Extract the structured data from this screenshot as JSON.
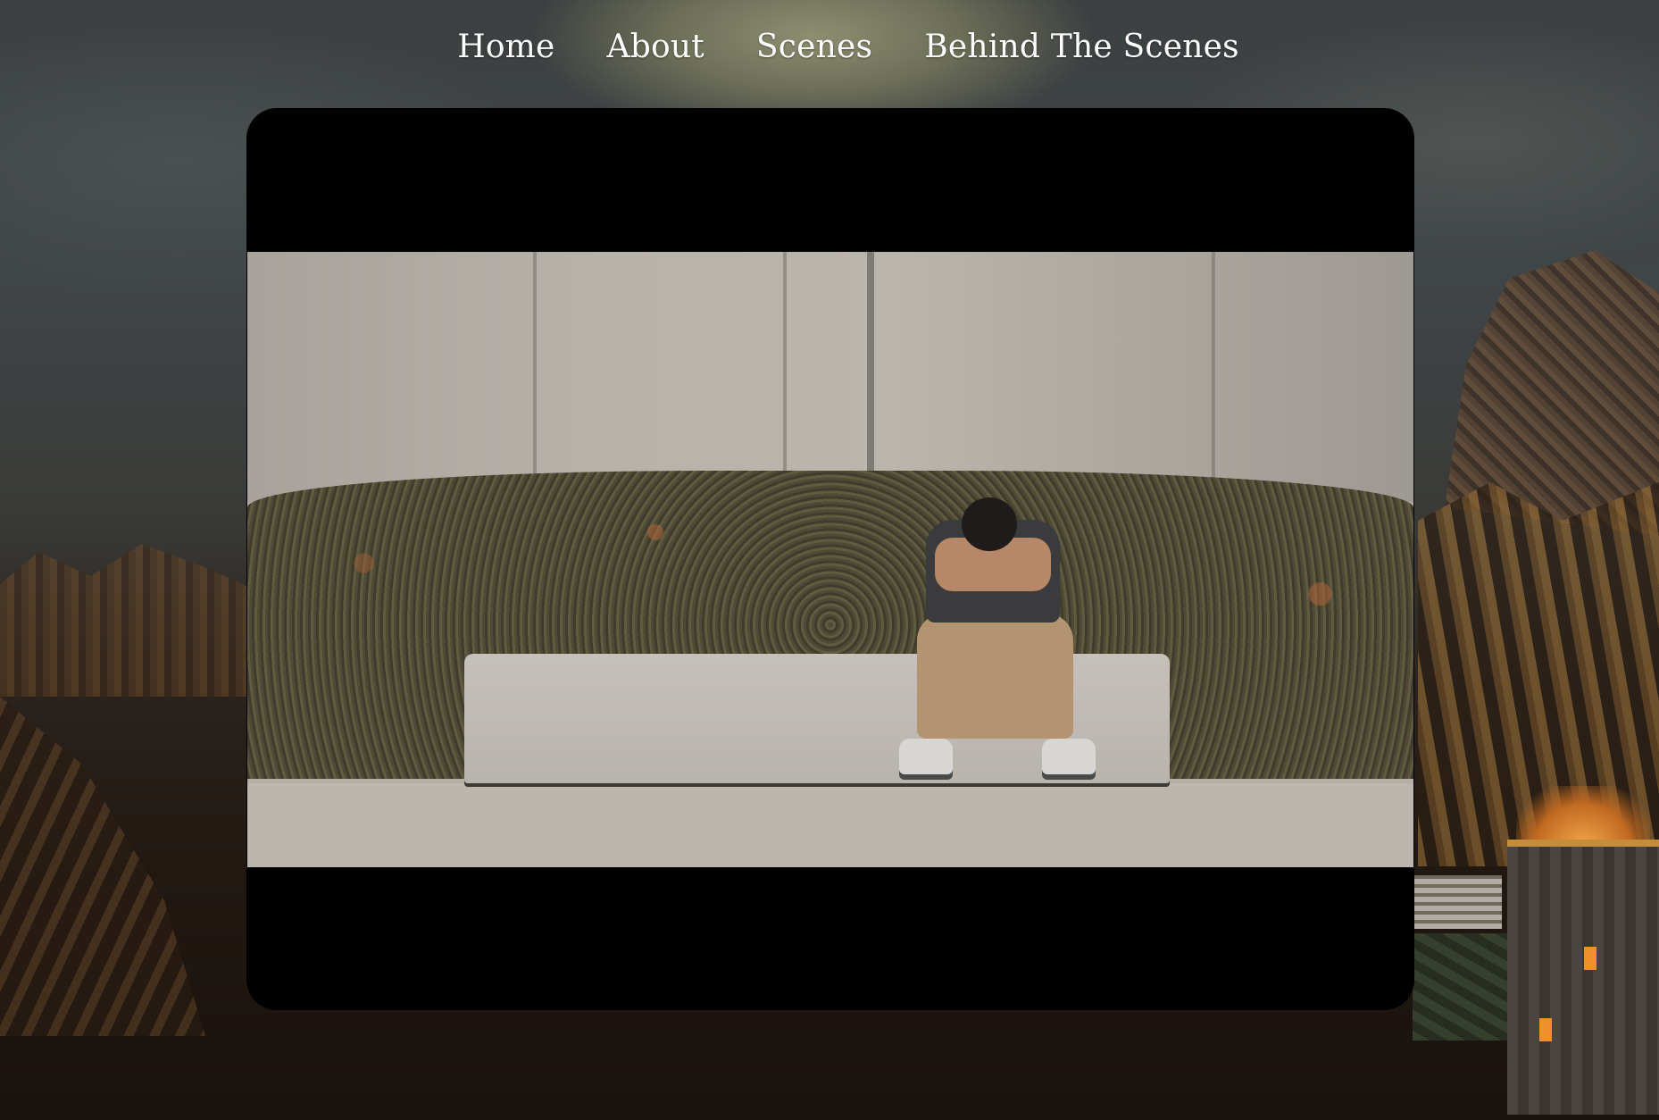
{
  "nav": {
    "items": [
      {
        "label": "Home"
      },
      {
        "label": "About"
      },
      {
        "label": "Scenes"
      },
      {
        "label": "Behind The Scenes"
      }
    ]
  },
  "video": {
    "description_icon": "video-still",
    "letterbox_color": "#000000"
  },
  "colors": {
    "nav_text": "#ffffff",
    "card_background": "#000000"
  }
}
